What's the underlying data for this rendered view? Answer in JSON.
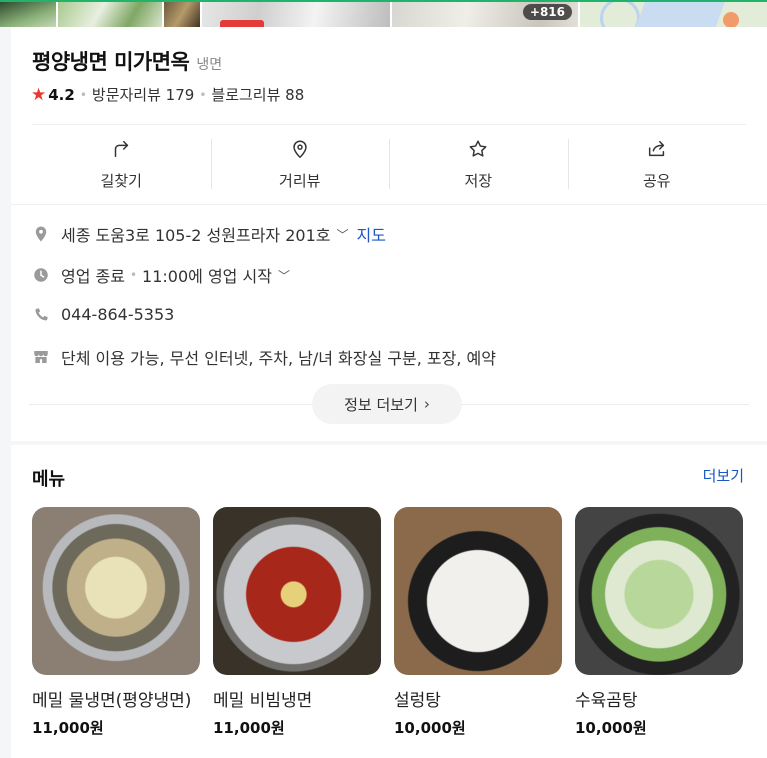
{
  "photos": {
    "more_count": "+816"
  },
  "place": {
    "name": "평양냉면 미가면옥",
    "category": "냉면",
    "rating": "4.2",
    "visitor_reviews": "방문자리뷰 179",
    "blog_reviews": "블로그리뷰 88"
  },
  "actions": [
    {
      "label": "길찾기",
      "icon": "directions-icon"
    },
    {
      "label": "거리뷰",
      "icon": "map-pin-icon"
    },
    {
      "label": "저장",
      "icon": "star-icon"
    },
    {
      "label": "공유",
      "icon": "share-icon"
    }
  ],
  "info": {
    "address": "세종 도움3로 105-2 성원프라자 201호",
    "map_link": "지도",
    "status": "영업 종료",
    "status_sub": "11:00에 영업 시작",
    "phone": "044-864-5353",
    "amenities": "단체 이용 가능, 무선 인터넷, 주차, 남/녀 화장실 구분, 포장, 예약",
    "more_label": "정보 더보기"
  },
  "menu": {
    "title": "메뉴",
    "more_label": "더보기",
    "items": [
      {
        "name": "메밀 물냉면(평양냉면)",
        "price": "11,000원"
      },
      {
        "name": "메밀 비빔냉면",
        "price": "11,000원"
      },
      {
        "name": "설렁탕",
        "price": "10,000원"
      },
      {
        "name": "수육곰탕",
        "price": "10,000원"
      }
    ]
  },
  "colors": {
    "accent_link": "#1a56c7",
    "star": "#e8382f"
  }
}
